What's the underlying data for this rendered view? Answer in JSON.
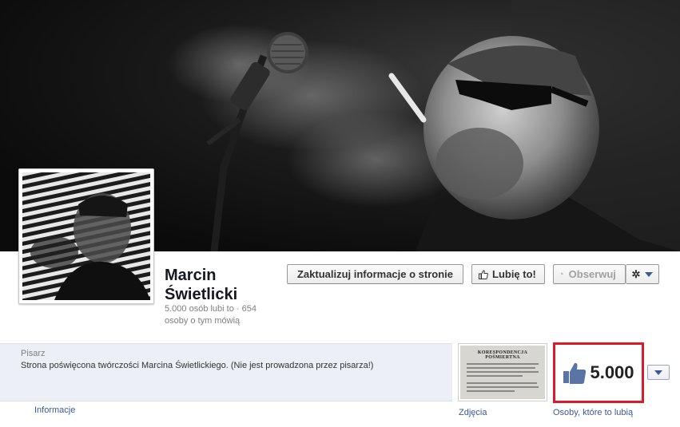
{
  "page": {
    "name_line1": "Marcin",
    "name_line2": "Świetlicki",
    "stats_text": "5.000 osób lubi to · 654 osoby o tym mówią"
  },
  "actions": {
    "update_info_label": "Zaktualizuj informacje o stronie",
    "like_label": "Lubię to!",
    "follow_label": "Obserwuj"
  },
  "about": {
    "category": "Pisarz",
    "description": "Strona poświęcona twórczości Marcina Świetlickiego. (Nie jest prowadzona przez pisarza!)",
    "info_link": "Informacje"
  },
  "apps": {
    "photos": {
      "label": "Zdjęcia",
      "thumb_title": "KORESPONDENCJA POŚMIERTNA"
    },
    "likes": {
      "label": "Osoby, które to lubią",
      "count": "5.000"
    }
  },
  "icons": {
    "like_button": "thumbs-up-icon",
    "follow_button": "rss-icon",
    "settings": "gear-icon",
    "dropdown": "chevron-down-icon"
  },
  "colors": {
    "link": "#3b5998",
    "highlight_border": "#dd1a2a",
    "info_background": "#eceff5"
  }
}
